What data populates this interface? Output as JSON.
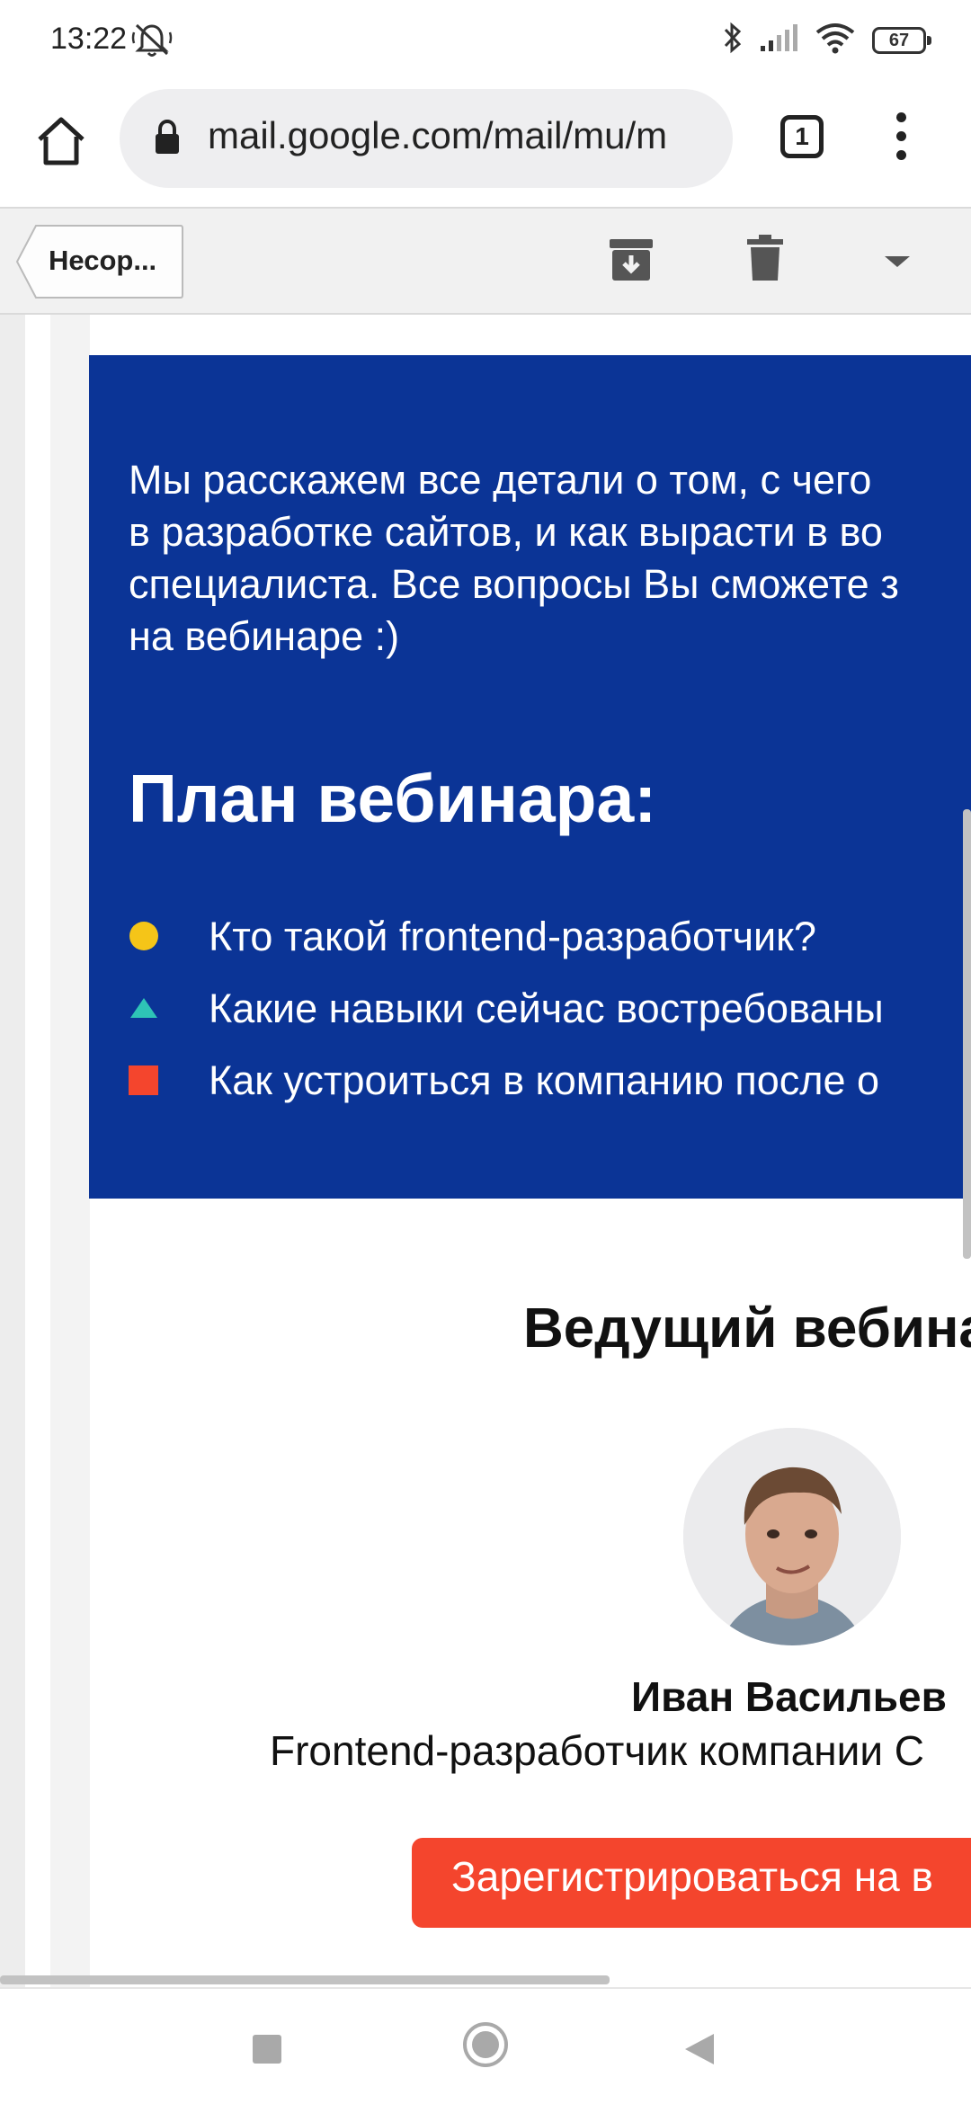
{
  "status": {
    "time": "13:22",
    "battery": "67"
  },
  "browser": {
    "url": "mail.google.com/mail/mu/m",
    "tab_count": "1"
  },
  "mail_toolbar": {
    "back_label": "Несор..."
  },
  "email": {
    "intro_lines": [
      "Мы расскажем все детали о том, с чего",
      "в разработке сайтов, и как вырасти в во",
      "специалиста. Все вопросы Вы сможете з",
      "на вебинаре :)"
    ],
    "plan_title": "План вебинара:",
    "plan_items": [
      {
        "text": "Кто такой frontend-разработчик?",
        "marker": "circle",
        "color": "#f5c518"
      },
      {
        "text": "Какие навыки сейчас востребованы",
        "marker": "triangle",
        "color": "#2ec4b6"
      },
      {
        "text": "Как устроиться в компанию после о",
        "marker": "square",
        "color": "#f4452d"
      }
    ],
    "presenter_title": "Ведущий вебина",
    "presenter_name": "Иван Васильев",
    "presenter_role": "Frontend-разработчик компании С",
    "register_label": "Зарегистрироваться на в"
  },
  "colors": {
    "blue_block": "#0b3496",
    "register_button": "#f4452d"
  },
  "icons": {
    "home": "home-icon",
    "lock": "lock-icon",
    "archive": "archive-icon",
    "trash": "trash-icon",
    "dropdown": "chevron-down-icon"
  }
}
